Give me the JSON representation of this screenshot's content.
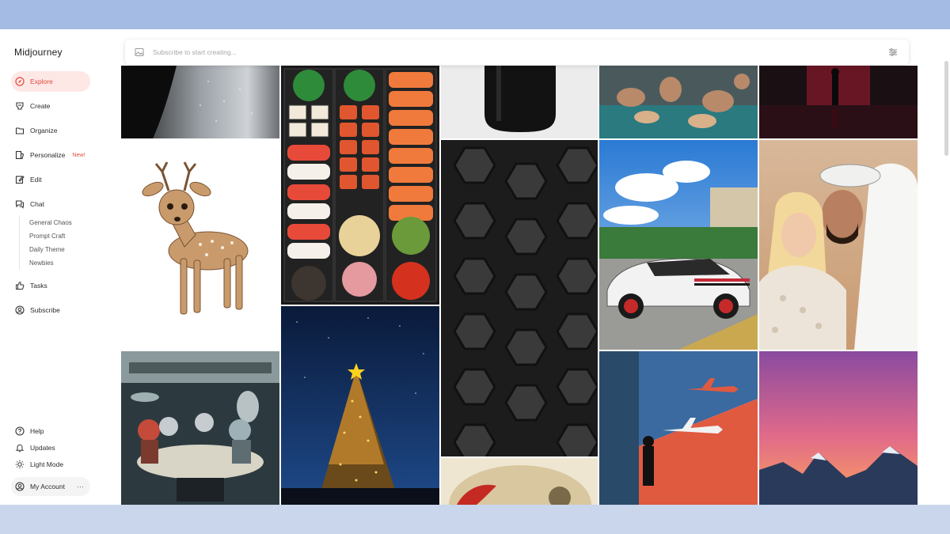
{
  "app": {
    "name": "Midjourney"
  },
  "nav": {
    "items": [
      {
        "label": "Explore",
        "icon": "compass-icon",
        "active": true
      },
      {
        "label": "Create",
        "icon": "brush-icon"
      },
      {
        "label": "Organize",
        "icon": "folder-icon"
      },
      {
        "label": "Personalize",
        "icon": "personalize-icon",
        "badge": "New!"
      },
      {
        "label": "Edit",
        "icon": "edit-icon"
      },
      {
        "label": "Chat",
        "icon": "chat-icon"
      }
    ],
    "chat_rooms": [
      "General Chaos",
      "Prompt Craft",
      "Daily Theme",
      "Newbies"
    ],
    "lower_items": [
      {
        "label": "Tasks",
        "icon": "thumbs-up-icon"
      },
      {
        "label": "Subscribe",
        "icon": "user-circle-icon"
      }
    ],
    "footer_items": [
      {
        "label": "Help",
        "icon": "help-icon"
      },
      {
        "label": "Updates",
        "icon": "bell-icon"
      },
      {
        "label": "Light Mode",
        "icon": "sun-icon"
      }
    ],
    "account": {
      "label": "My Account",
      "menu": "···",
      "icon": "account-icon"
    }
  },
  "search": {
    "placeholder": "Subscribe to start creating..."
  },
  "colors": {
    "accent": "#e04b3e",
    "accent_bg": "#fde8e6",
    "frame_top": "#a4bce3",
    "frame_bottom": "#c9d6ec"
  },
  "gallery": {
    "images": [
      "glitter-closeup",
      "deer-fawn",
      "retro-aliens-poker",
      "sushi-bento",
      "christmas-tree-night",
      "black-bottle",
      "hexagon-wall",
      "red-shoe-closeup",
      "surreal-storm-people",
      "white-porsche",
      "airplane-print",
      "rainy-street-neon",
      "selfie-couple",
      "pink-sunset-mountains"
    ]
  }
}
